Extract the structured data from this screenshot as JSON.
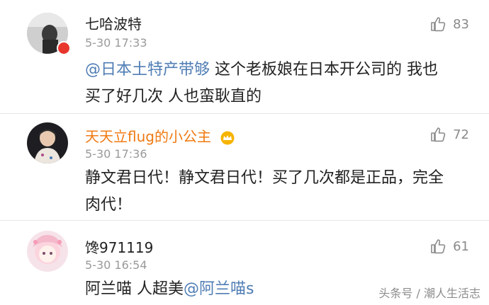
{
  "comments": [
    {
      "username": "七哈波特",
      "time": "5-30 17:33",
      "likes": "83",
      "mention": "@日本土特产带够",
      "text_line1": " 这个老板娘在日本开公司的 我也",
      "text_line2": "买了好几次 人也蛮耿直的"
    },
    {
      "username": "天天立flug的小公主",
      "time": "5-30 17:36",
      "likes": "72",
      "text_line1": "静文君日代！静文君日代！买了几次都是正品，完全",
      "text_line2": "肉代！"
    },
    {
      "username": "馋971119",
      "time": "5-30 16:54",
      "likes": "61",
      "text_before": "阿兰喵 人超美",
      "mention": "@阿兰喵s"
    }
  ],
  "watermark": "头条号 / 潮人生活志",
  "colors": {
    "mention": "#4f7db4",
    "vip_name": "#f07a12",
    "time": "#9a9a9a"
  }
}
